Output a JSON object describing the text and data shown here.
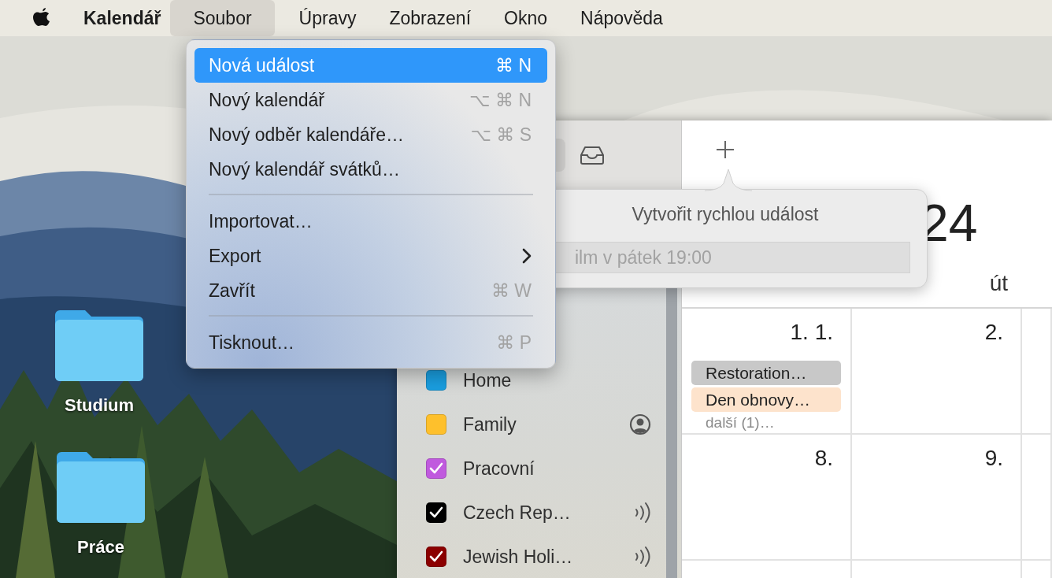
{
  "menu_bar": {
    "app_name": "Kalendář",
    "menus": [
      {
        "label": "Soubor",
        "selected": true
      },
      {
        "label": "Úpravy",
        "selected": false
      },
      {
        "label": "Zobrazení",
        "selected": false
      },
      {
        "label": "Okno",
        "selected": false
      },
      {
        "label": "Nápověda",
        "selected": false
      }
    ]
  },
  "file_menu": {
    "items": [
      {
        "kind": "item",
        "label": "Nová událost",
        "shortcut": "⌘ N",
        "selected": true
      },
      {
        "kind": "item",
        "label": "Nový kalendář",
        "shortcut": "⌥ ⌘ N",
        "selected": false
      },
      {
        "kind": "item",
        "label": "Nový odběr kalendáře…",
        "shortcut": "⌥ ⌘ S",
        "selected": false
      },
      {
        "kind": "item",
        "label": "Nový kalendář svátků…",
        "selected": false
      },
      {
        "kind": "separator"
      },
      {
        "kind": "item",
        "label": "Importovat…",
        "selected": false
      },
      {
        "kind": "submenu",
        "label": "Export",
        "selected": false
      },
      {
        "kind": "item",
        "label": "Zavřít",
        "shortcut": "⌘ W",
        "selected": false
      },
      {
        "kind": "separator"
      },
      {
        "kind": "item",
        "label": "Tisknout…",
        "shortcut": "⌘ P",
        "selected": false
      }
    ]
  },
  "desktop_icons": [
    {
      "label": "Studium"
    },
    {
      "label": "Práce"
    }
  ],
  "sidebar": {
    "calendars": [
      {
        "name": "Home",
        "color": "#1a9ee0",
        "checked": false,
        "kind": "local"
      },
      {
        "name": "Family",
        "color": "#fec02c",
        "checked": false,
        "kind": "shared"
      },
      {
        "name": "Pracovní",
        "color": "#c05ade",
        "checked": true,
        "kind": "local"
      },
      {
        "name": "Czech Rep…",
        "color": "#000000",
        "checked": true,
        "kind": "subscribed"
      },
      {
        "name": "Jewish Holi…",
        "color": "#8b0000",
        "checked": true,
        "kind": "subscribed"
      }
    ]
  },
  "quick_event": {
    "title": "Vytvořit rychlou událost",
    "placeholder": "ilm v pátek 19:00"
  },
  "calendar": {
    "year": "24",
    "weekdays": [
      "út"
    ],
    "weeks": [
      [
        {
          "date": "1. 1.",
          "events": [
            {
              "title": "Restoration…",
              "color": "#c8c8c8"
            },
            {
              "title": "Den obnovy…",
              "color": "#fde3cc"
            }
          ],
          "more": "další (1)…"
        },
        {
          "date": "2."
        }
      ],
      [
        {
          "date": "8."
        },
        {
          "date": "9."
        }
      ]
    ]
  }
}
